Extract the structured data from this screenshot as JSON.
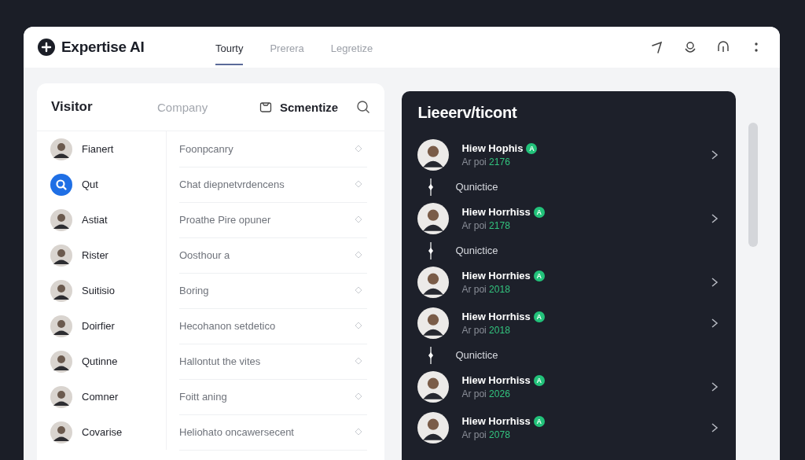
{
  "app": {
    "title": "Expertise AI"
  },
  "tabs": [
    {
      "label": "Tourty",
      "selected": true
    },
    {
      "label": "Prerera",
      "selected": false
    },
    {
      "label": "Legretize",
      "selected": false
    }
  ],
  "visitors": {
    "columns": [
      "Visitor",
      "Company",
      "Scmentize"
    ],
    "rows": [
      {
        "kind": "photo",
        "name": "Fianert",
        "company": "Foonpcanry"
      },
      {
        "kind": "search",
        "name": "Qut",
        "company": "Chat diepnetvrdencens"
      },
      {
        "kind": "photo",
        "name": "Astiat",
        "company": "Proathe Pire opuner"
      },
      {
        "kind": "photo",
        "name": "Rister",
        "company": "Oosthour a"
      },
      {
        "kind": "photo",
        "name": "Suitisio",
        "company": "Boring"
      },
      {
        "kind": "photo",
        "name": "Doirfier",
        "company": "Hecohanon setdetico"
      },
      {
        "kind": "photo",
        "name": "Qutinne",
        "company": "Hallontut the vites"
      },
      {
        "kind": "photo",
        "name": "Comner",
        "company": "Foitt aning"
      },
      {
        "kind": "photo",
        "name": "Covarise",
        "company": "Heliohato oncawersecent"
      }
    ]
  },
  "panel": {
    "title": "Lieeerv/ticont",
    "items": [
      {
        "kind": "person",
        "name": "Hiew Hophis",
        "badge": "A",
        "sub": "Ar poi",
        "number": "2176"
      },
      {
        "kind": "divider",
        "label": "Qunictice"
      },
      {
        "kind": "person",
        "name": "Hiew Horrhiss",
        "badge": "A",
        "sub": "Ar poi",
        "number": "2178"
      },
      {
        "kind": "divider",
        "label": "Qunictice"
      },
      {
        "kind": "person",
        "name": "Hiew Horrhies",
        "badge": "A",
        "sub": "Ar poi",
        "number": "2018"
      },
      {
        "kind": "person",
        "name": "Hiew Horrhiss",
        "badge": "A",
        "sub": "Ar poi",
        "number": "2018"
      },
      {
        "kind": "divider",
        "label": "Qunictice"
      },
      {
        "kind": "person",
        "name": "Hiew Horrhiss",
        "badge": "A",
        "sub": "Ar poi",
        "number": "2026"
      },
      {
        "kind": "person",
        "name": "Hiew Horrhiss",
        "badge": "A",
        "sub": "Ar poi",
        "number": "2078"
      }
    ]
  }
}
